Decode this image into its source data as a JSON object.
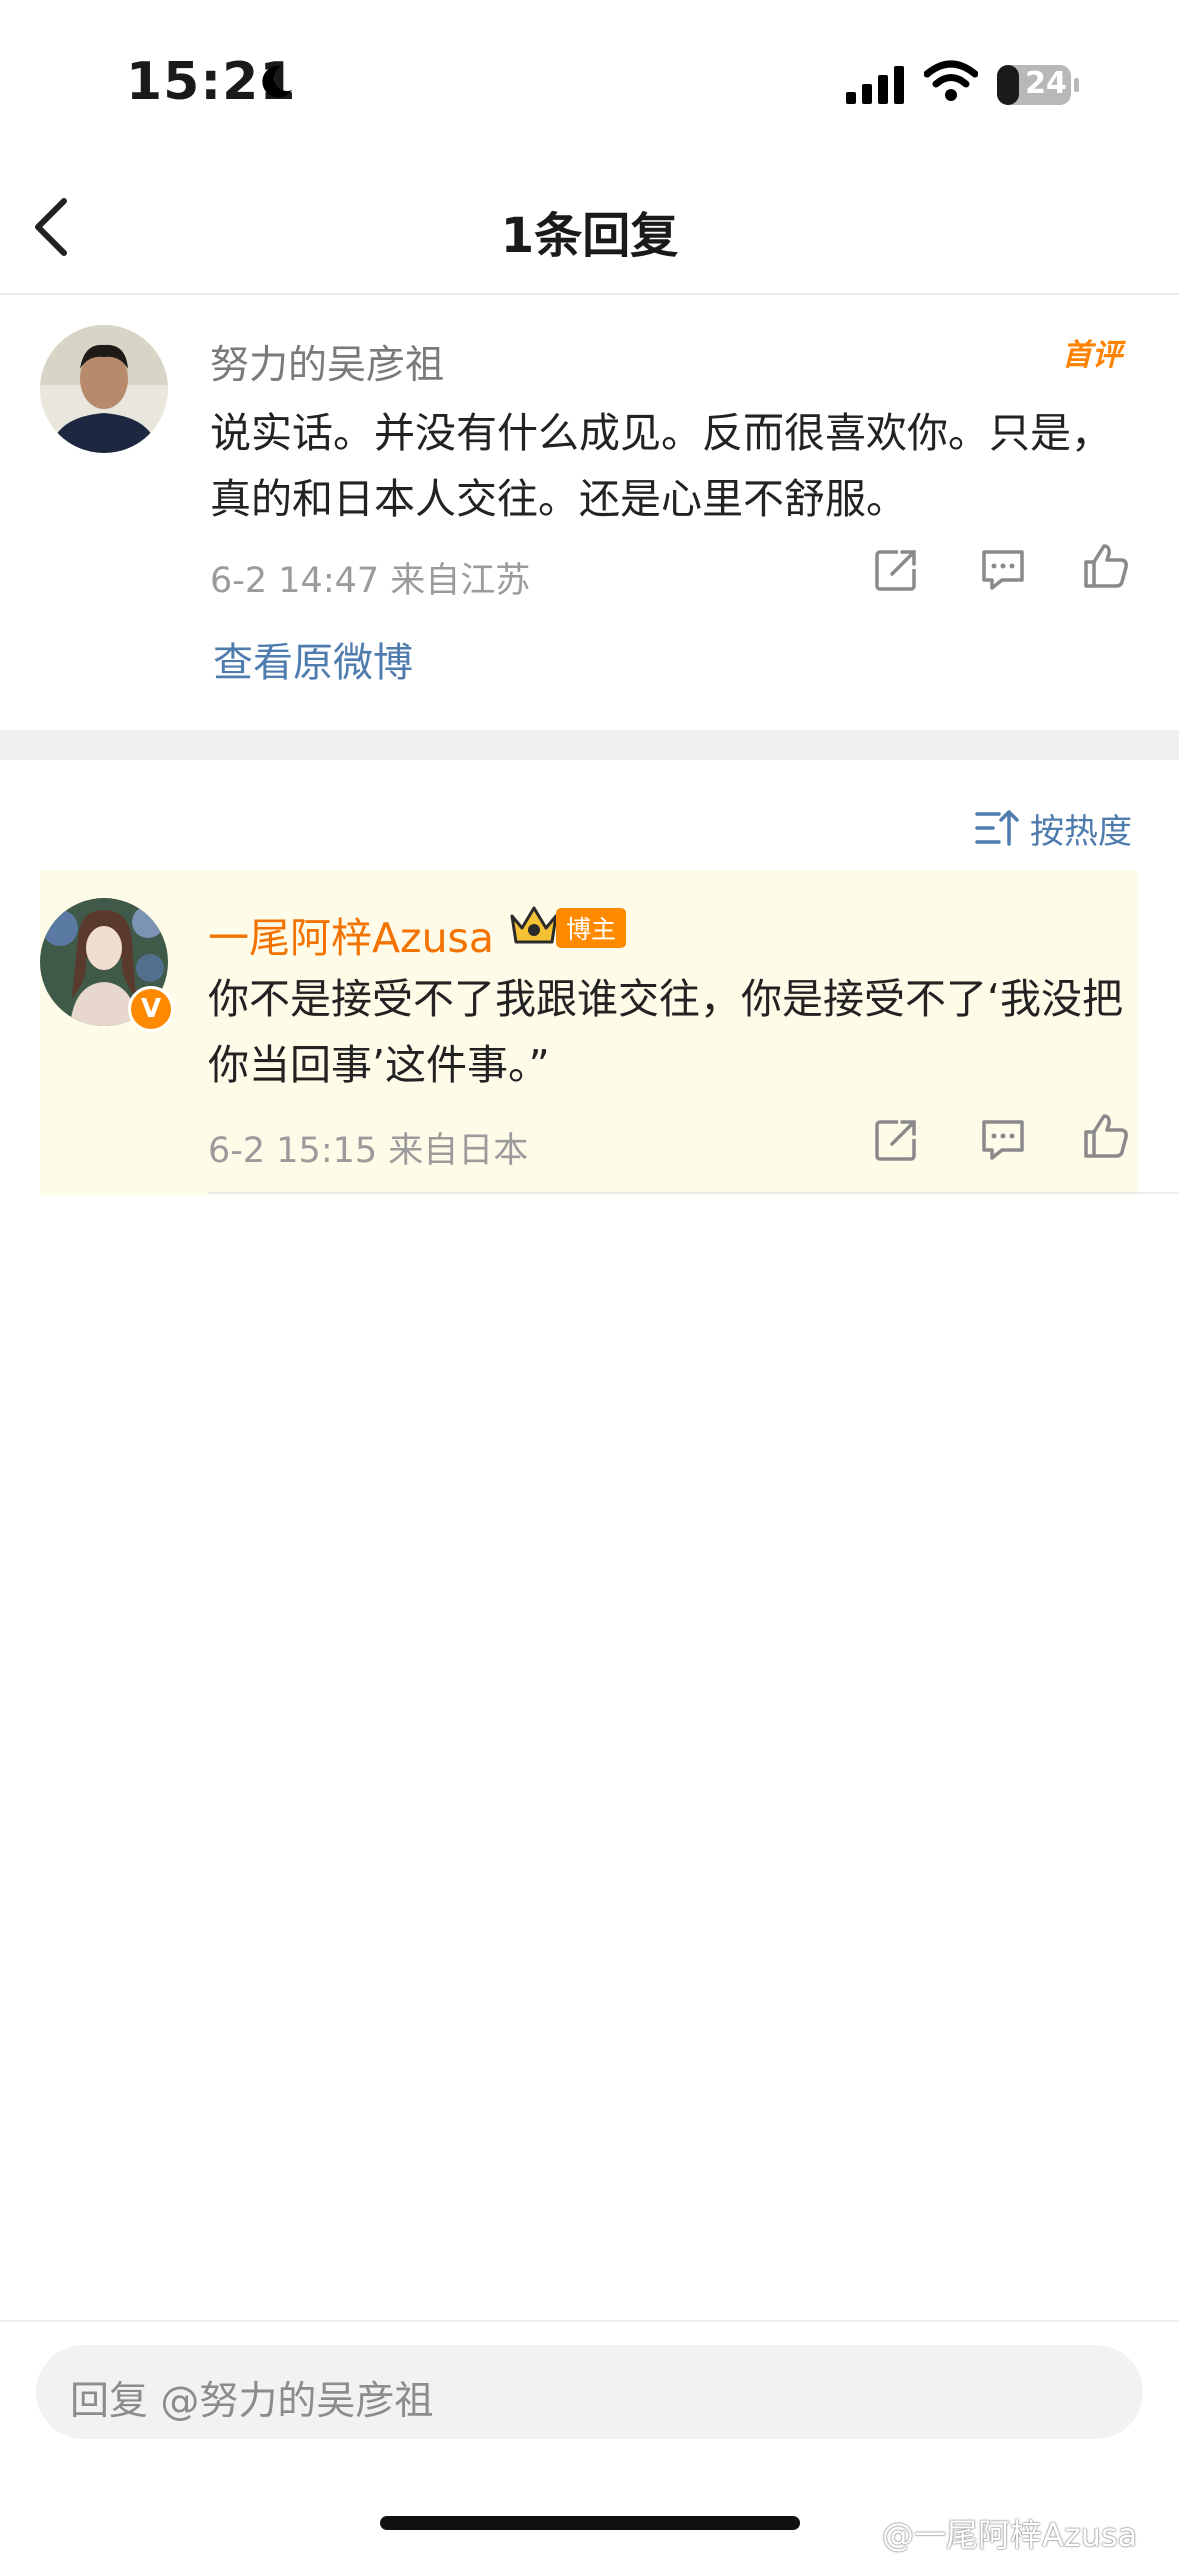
{
  "status_bar": {
    "time": "15:21",
    "battery": "24"
  },
  "header": {
    "title": "1条回复"
  },
  "original_comment": {
    "author": "努力的吴彦祖",
    "badge": "首评",
    "text": "说实话。并没有什么成见。反而很喜欢你。只是，真的和日本人交往。还是心里不舒服。",
    "meta": "6-2 14:47  来自江苏",
    "view_original": "查看原微博"
  },
  "sort": {
    "label": "按热度"
  },
  "reply": {
    "author": "一尾阿梓Azusa",
    "verified_mark": "V",
    "role_badge": "博主",
    "text": "你不是接受不了我跟谁交往，你是接受不了‘我没把你当回事’这件事。”",
    "meta": "6-2 15:15  来自日本"
  },
  "reply_bar": {
    "placeholder": "回复 @努力的吴彦祖"
  },
  "watermark": "@一尾阿梓Azusa",
  "colors": {
    "link": "#4f7cae",
    "accent": "#ff8200",
    "reply_bg": "#fffbe9"
  }
}
